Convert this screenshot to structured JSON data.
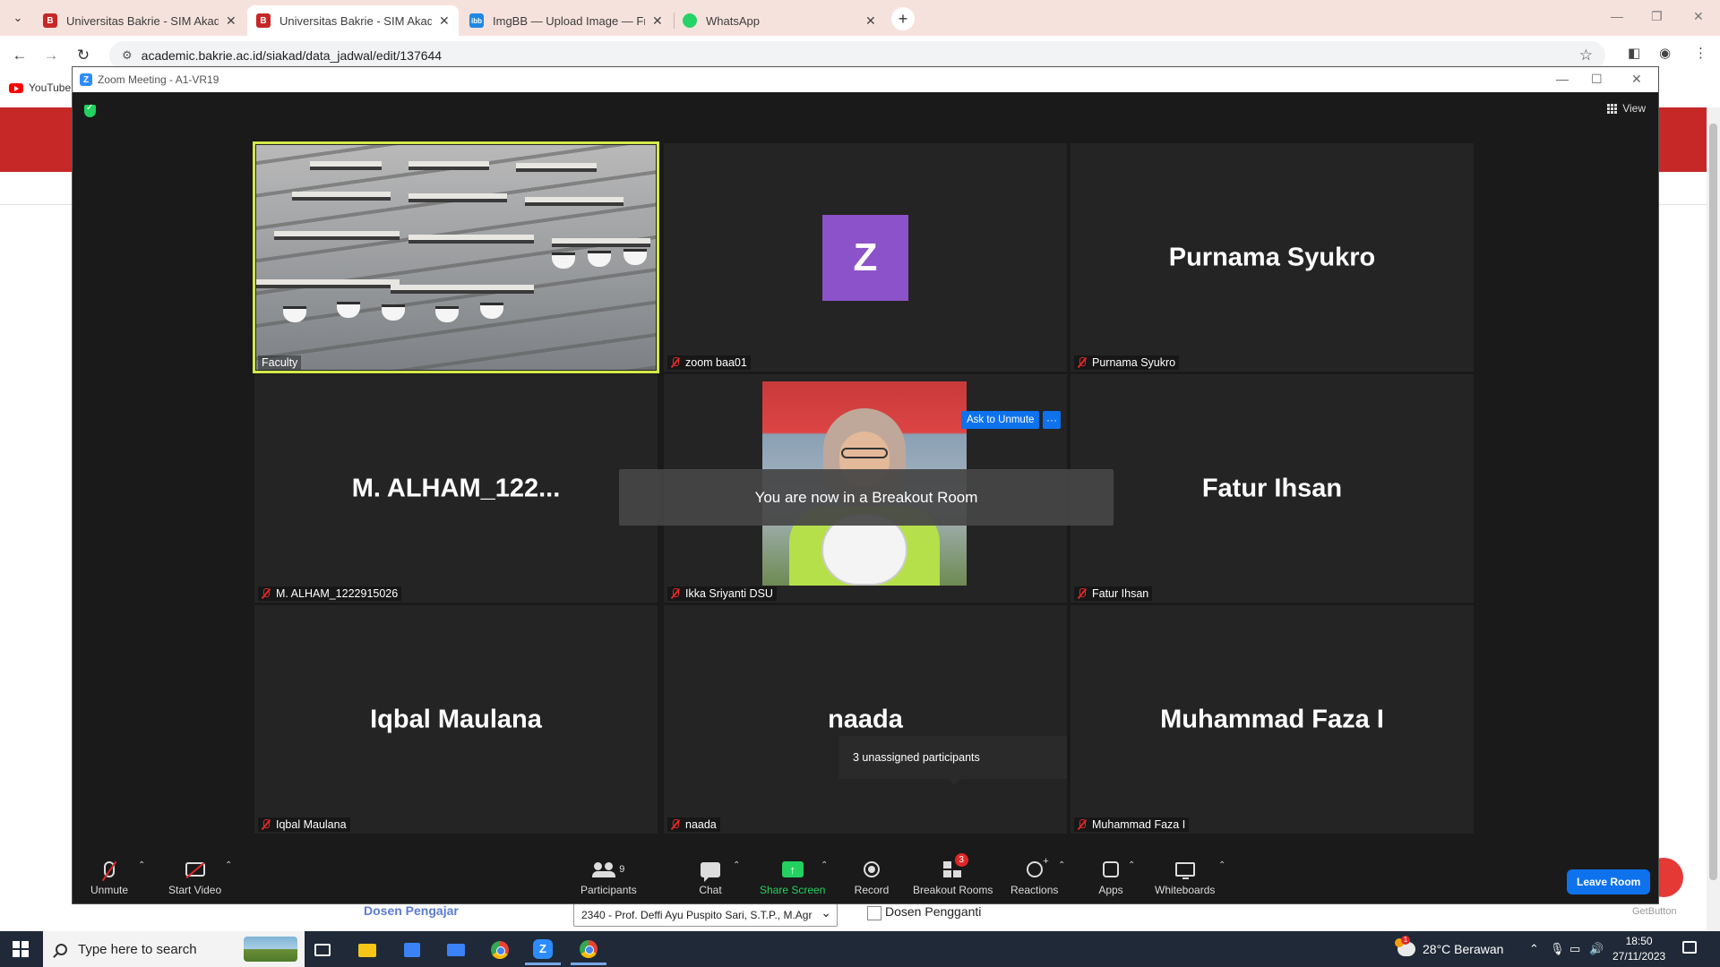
{
  "browser": {
    "tabs": [
      {
        "title": "Universitas Bakrie - SIM Akadem",
        "active": false,
        "icon": "bakrie-favicon"
      },
      {
        "title": "Universitas Bakrie - SIM Akadem",
        "active": true,
        "icon": "bakrie-favicon"
      },
      {
        "title": "ImgBB — Upload Image — Free",
        "active": false,
        "icon": "imgbb-favicon"
      },
      {
        "title": "WhatsApp",
        "active": false,
        "icon": "whatsapp-favicon"
      }
    ],
    "tab_close": "✕",
    "new_tab": "+",
    "url": "academic.bakrie.ac.id/siakad/data_jadwal/edit/137644",
    "bookmark": "YouTube"
  },
  "background_page": {
    "dosen_label": "Dosen Pengajar",
    "dosen_value": "2340 - Prof. Deffi Ayu Puspito Sari, S.T.P., M.Agr",
    "pengganti_label": "Dosen Pengganti",
    "getbutton": "GetButton"
  },
  "zoom": {
    "window_title": "Zoom Meeting - A1-VR19",
    "view_label": "View",
    "tiles": [
      {
        "display": "",
        "tag": "Faculty",
        "muted": false,
        "video": true
      },
      {
        "display": "Z",
        "tag": "zoom baa01",
        "muted": true,
        "video": false
      },
      {
        "display": "Purnama Syukro",
        "tag": "Purnama Syukro",
        "muted": true,
        "video": false
      },
      {
        "display": "M.  ALHAM_122...",
        "tag": "M. ALHAM_1222915026",
        "muted": true,
        "video": false
      },
      {
        "display": "",
        "tag": "Ikka Sriyanti DSU",
        "muted": true,
        "video": true
      },
      {
        "display": "Fatur Ihsan",
        "tag": "Fatur Ihsan",
        "muted": true,
        "video": false
      },
      {
        "display": "Iqbal Maulana",
        "tag": "Iqbal Maulana",
        "muted": true,
        "video": false
      },
      {
        "display": "naada",
        "tag": "naada",
        "muted": true,
        "video": false
      },
      {
        "display": "Muhammad Faza I",
        "tag": "Muhammad Faza I",
        "muted": true,
        "video": false
      }
    ],
    "ask_unmute": "Ask to Unmute",
    "more": "···",
    "toast": "You are now in a Breakout Room",
    "unassigned": "3 unassigned participants",
    "toolbar": {
      "unmute": "Unmute",
      "start_video": "Start Video",
      "participants": "Participants",
      "participants_count": "9",
      "chat": "Chat",
      "share_screen": "Share Screen",
      "record": "Record",
      "breakout_rooms": "Breakout Rooms",
      "breakout_badge": "3",
      "reactions": "Reactions",
      "apps": "Apps",
      "whiteboards": "Whiteboards",
      "leave": "Leave Room",
      "caret": "⌃"
    },
    "accent_color": "#0e72ed",
    "share_color": "#23d160",
    "speaker_outline": "#d3e84a"
  },
  "taskbar": {
    "search_placeholder": "Type here to search",
    "weather": "28°C  Berawan",
    "time": "18:50",
    "date": "27/11/2023"
  }
}
